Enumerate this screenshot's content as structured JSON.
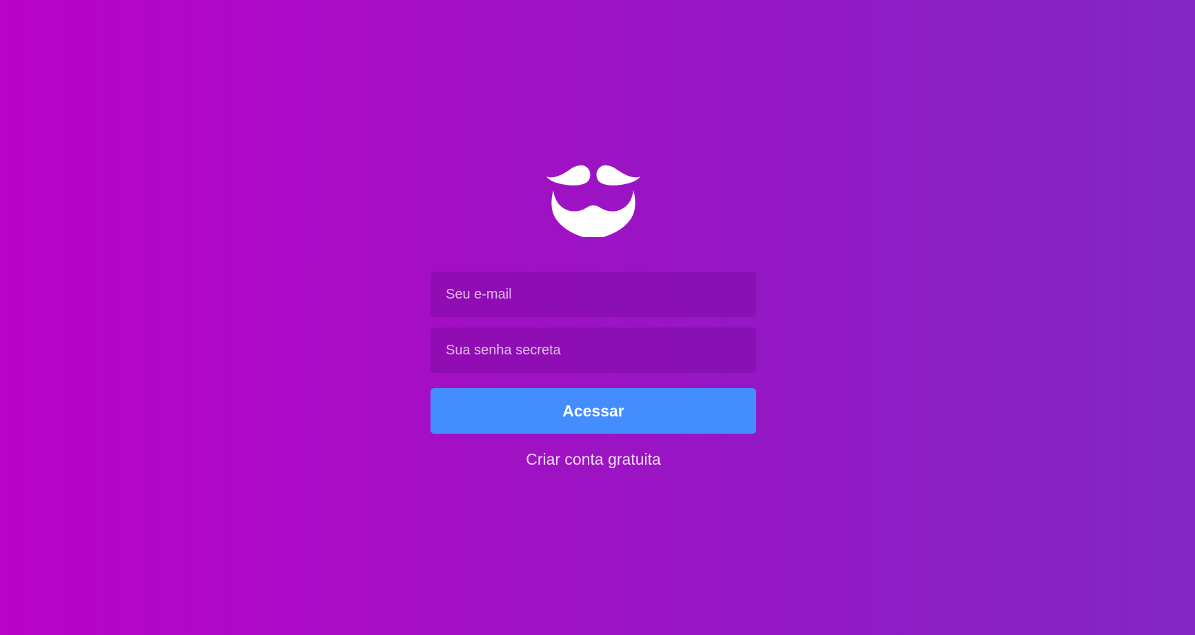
{
  "brand": {
    "logo_icon": "beard-mustache-icon"
  },
  "form": {
    "email_placeholder": "Seu e-mail",
    "password_placeholder": "Sua senha secreta",
    "submit_label": "Acessar",
    "signup_link": "Criar conta gratuita"
  },
  "colors": {
    "background_left": "#BA02C8",
    "background_right": "#8227C4",
    "button": "#448DFF",
    "text": "#FFFFFF"
  }
}
